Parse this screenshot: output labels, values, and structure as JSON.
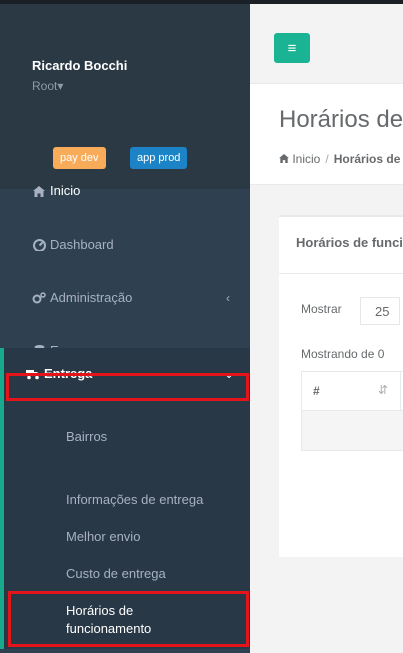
{
  "sidebar": {
    "profile": {
      "name": "Ricardo Bocchi",
      "role": "Root",
      "role_caret": "▾"
    },
    "badges": {
      "dev": "pay dev",
      "prod": "app prod"
    },
    "menu": {
      "inicio": "Inicio",
      "dashboard": "Dashboard",
      "administracao": "Administração",
      "empresa": "Empresa",
      "entrega": "Entrega"
    },
    "arrows": {
      "collapsed": "‹",
      "expanded": "⌄"
    },
    "submenu": {
      "bairros": "Bairros",
      "informacoes": "Informações de entrega",
      "melhor_envio": "Melhor envio",
      "custo": "Custo de entrega",
      "horarios_l1": "Horários de",
      "horarios_l2": "funcionamento"
    }
  },
  "topbar": {
    "hamburger": "≡"
  },
  "page": {
    "title": "Horários de funcionamento",
    "breadcrumb": {
      "home": "Inicio",
      "sep": "/",
      "current": "Horários de funcionamento"
    }
  },
  "box": {
    "title": "Horários de funcionamento",
    "show_label": "Mostrar",
    "page_size": "25",
    "info": "Mostrando de 0",
    "table": {
      "col_hash": "#",
      "sort": "⇵"
    }
  },
  "colors": {
    "sidebar": "#2f4050",
    "accent": "#1ab394",
    "highlight": "#e3141a",
    "badge_dev": "#f8ac59",
    "badge_prod": "#1c84c6"
  }
}
